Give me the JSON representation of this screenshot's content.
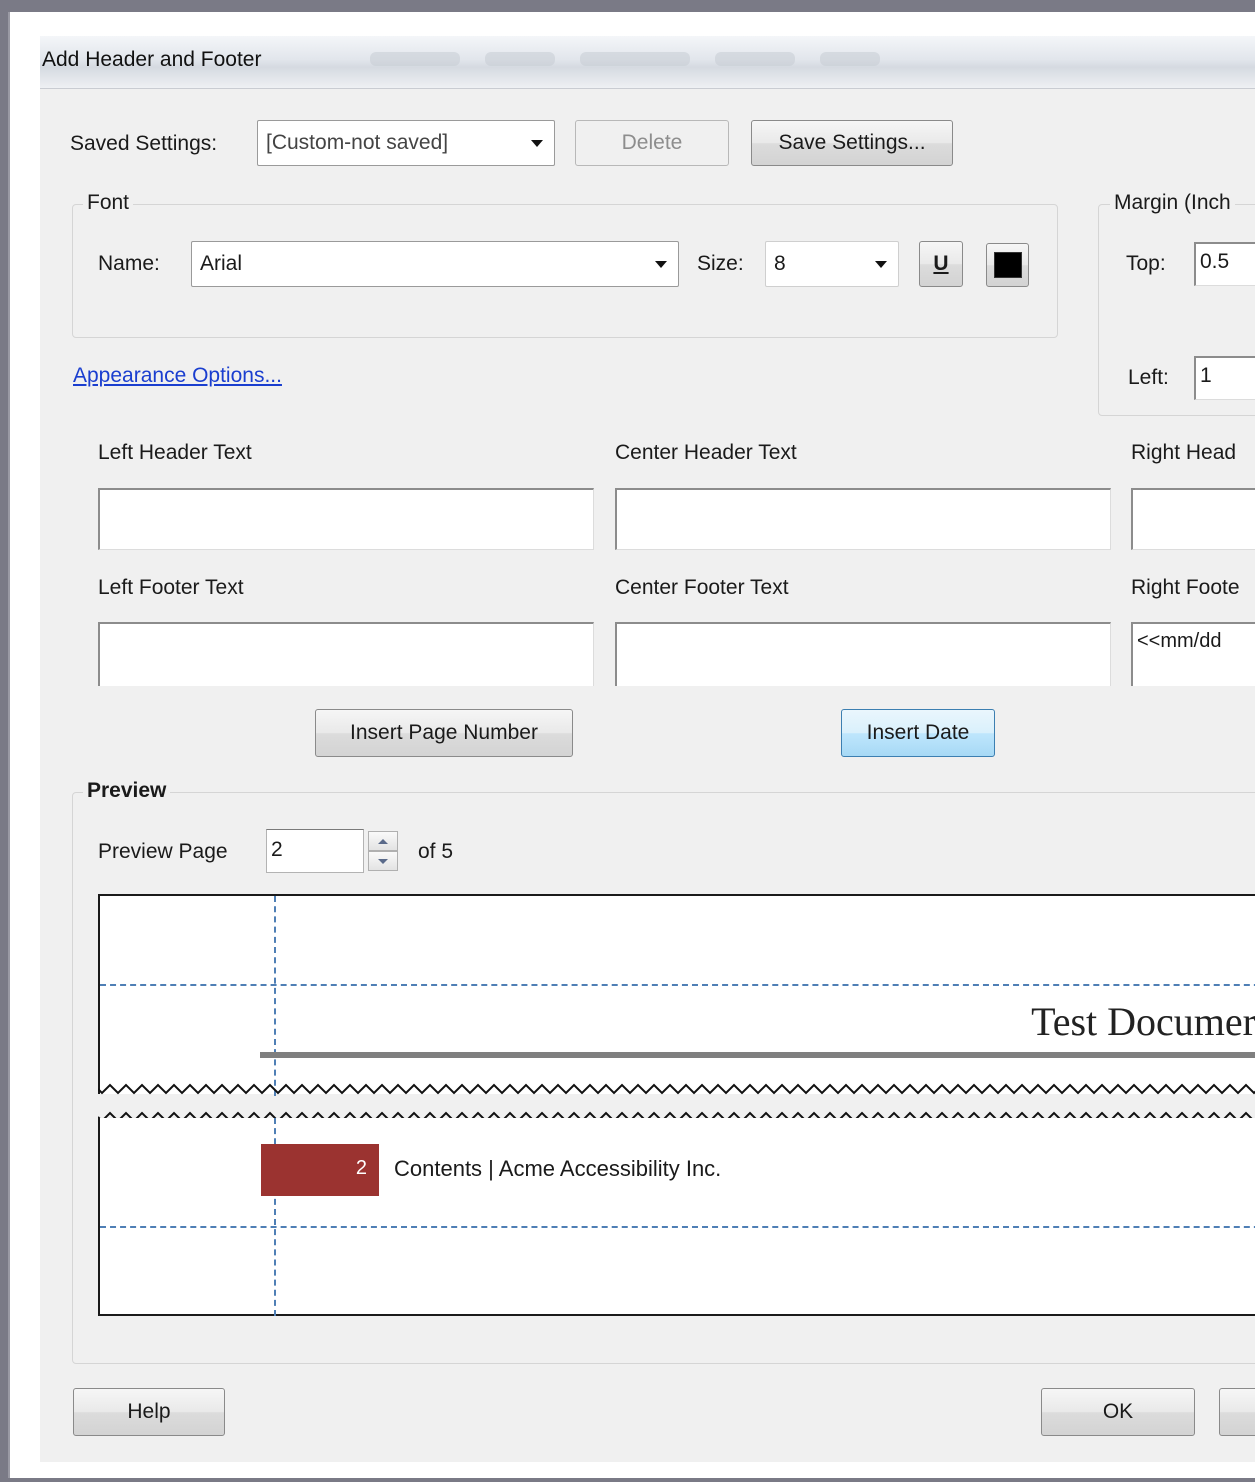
{
  "window": {
    "title": "Add Header and Footer"
  },
  "saved_settings": {
    "label": "Saved Settings:",
    "value": "[Custom-not saved]",
    "delete_label": "Delete",
    "save_label": "Save Settings..."
  },
  "font": {
    "group_title": "Font",
    "name_label": "Name:",
    "name_value": "Arial",
    "size_label": "Size:",
    "size_value": "8",
    "underline_glyph": "U",
    "color_value": "#000000"
  },
  "margin": {
    "group_title": "Margin (Inch",
    "top_label": "Top:",
    "top_value": "0.5",
    "left_label": "Left:",
    "left_value": "1"
  },
  "appearance_link": "Appearance Options...",
  "header_footer": {
    "left_header_label": "Left Header Text",
    "center_header_label": "Center Header Text",
    "right_header_label": "Right Head",
    "left_footer_label": "Left Footer Text",
    "center_footer_label": "Center Footer Text",
    "right_footer_label": "Right Foote",
    "left_header_value": "",
    "center_header_value": "",
    "right_header_value": "",
    "left_footer_value": "",
    "center_footer_value": "",
    "right_footer_value": "<<mm/dd"
  },
  "insert_page_number_label": "Insert Page Number",
  "insert_date_label": "Insert Date",
  "preview": {
    "group_title": "Preview",
    "page_label": "Preview Page",
    "page_value": "2",
    "of_label": "of 5",
    "doc_title": "Test Documer",
    "footer_page_number": "2",
    "footer_text": "Contents | Acme Accessibility Inc.",
    "footer_accent_color": "#9b3330"
  },
  "buttons": {
    "help_label": "Help",
    "ok_label": "OK"
  }
}
